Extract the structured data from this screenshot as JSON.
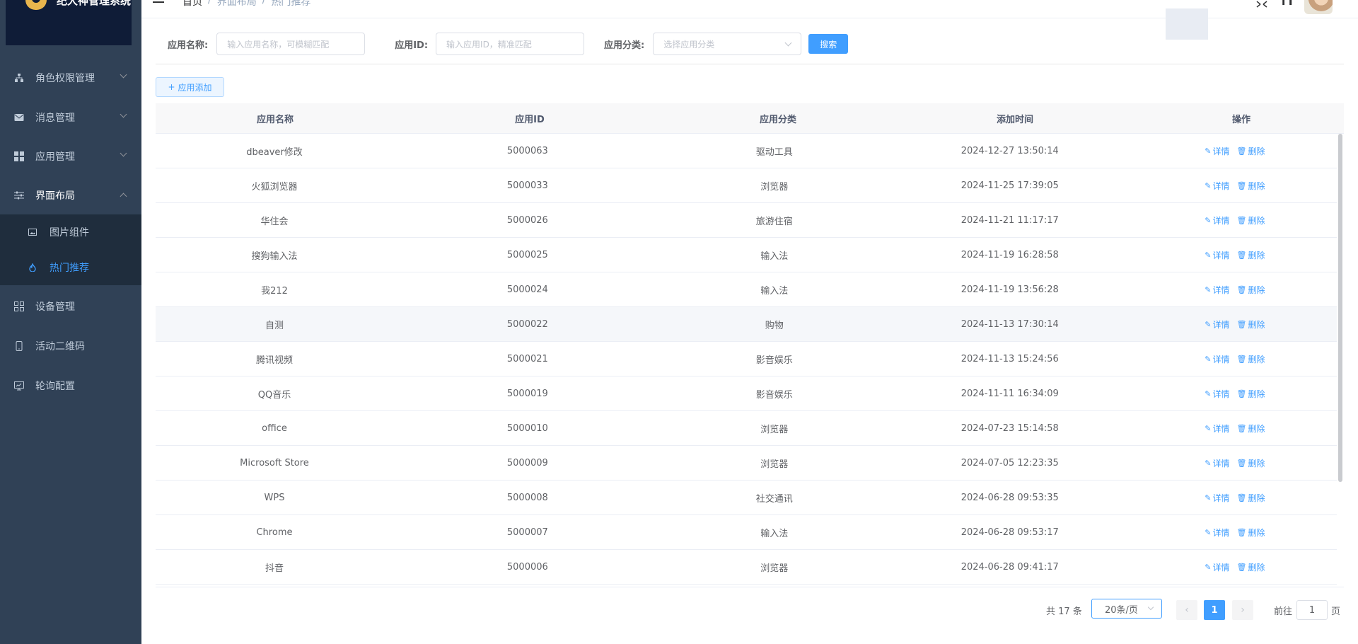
{
  "app": {
    "title": "纪大神管理系统"
  },
  "sidebar": {
    "items": [
      {
        "label": "角色权限管理",
        "icon": "sitemap-icon"
      },
      {
        "label": "消息管理",
        "icon": "envelope-icon"
      },
      {
        "label": "应用管理",
        "icon": "grid-icon"
      },
      {
        "label": "界面布局",
        "icon": "sliders-icon",
        "open": true
      },
      {
        "label": "设备管理",
        "icon": "apps-icon"
      },
      {
        "label": "活动二维码",
        "icon": "mobile-icon"
      },
      {
        "label": "轮询配置",
        "icon": "monitor-icon"
      }
    ],
    "submenu": [
      {
        "label": "图片组件",
        "icon": "image-icon"
      },
      {
        "label": "热门推荐",
        "icon": "fire-icon",
        "active": true
      }
    ]
  },
  "header": {
    "breadcrumb": [
      "首页",
      "/",
      "界面布局",
      "/",
      "热门推荐"
    ]
  },
  "search": {
    "name_label": "应用名称:",
    "name_placeholder": "输入应用名称，可模糊匹配",
    "id_label": "应用ID:",
    "id_placeholder": "输入应用ID，精准匹配",
    "category_label": "应用分类:",
    "category_placeholder": "选择应用分类",
    "search_button": "搜索"
  },
  "toolbar": {
    "add_button": "应用添加"
  },
  "table": {
    "headers": [
      "应用名称",
      "应用ID",
      "应用分类",
      "添加时间",
      "操作"
    ],
    "detail_label": "详情",
    "delete_label": "删除",
    "rows": [
      {
        "name": "dbeaver修改",
        "id": "5000063",
        "category": "驱动工具",
        "time": "2024-12-27 13:50:14"
      },
      {
        "name": "火狐浏览器",
        "id": "5000033",
        "category": "浏览器",
        "time": "2024-11-25 17:39:05"
      },
      {
        "name": "华住会",
        "id": "5000026",
        "category": "旅游住宿",
        "time": "2024-11-21 11:17:17"
      },
      {
        "name": "搜狗输入法",
        "id": "5000025",
        "category": "输入法",
        "time": "2024-11-19 16:28:58"
      },
      {
        "name": "我212",
        "id": "5000024",
        "category": "输入法",
        "time": "2024-11-19 13:56:28"
      },
      {
        "name": "自测",
        "id": "5000022",
        "category": "购物",
        "time": "2024-11-13 17:30:14"
      },
      {
        "name": "腾讯视频",
        "id": "5000021",
        "category": "影音娱乐",
        "time": "2024-11-13 15:24:56"
      },
      {
        "name": "QQ音乐",
        "id": "5000019",
        "category": "影音娱乐",
        "time": "2024-11-11 16:34:09"
      },
      {
        "name": "office",
        "id": "5000010",
        "category": "浏览器",
        "time": "2024-07-23 15:14:58"
      },
      {
        "name": "Microsoft Store",
        "id": "5000009",
        "category": "浏览器",
        "time": "2024-07-05 12:23:35"
      },
      {
        "name": "WPS",
        "id": "5000008",
        "category": "社交通讯",
        "time": "2024-06-28 09:53:35"
      },
      {
        "name": "Chrome",
        "id": "5000007",
        "category": "输入法",
        "time": "2024-06-28 09:53:17"
      },
      {
        "name": "抖音",
        "id": "5000006",
        "category": "浏览器",
        "time": "2024-06-28 09:41:17"
      }
    ]
  },
  "pagination": {
    "total": "共 17 条",
    "page_size": "20条/页",
    "prev": "‹",
    "current": "1",
    "next": "›",
    "goto_label": "前往",
    "goto_value": "1",
    "page_suffix": "页"
  },
  "colors": {
    "sidebar_bg": "#304156",
    "accent": "#409eff",
    "submenu_bg": "#1f2d3d"
  }
}
